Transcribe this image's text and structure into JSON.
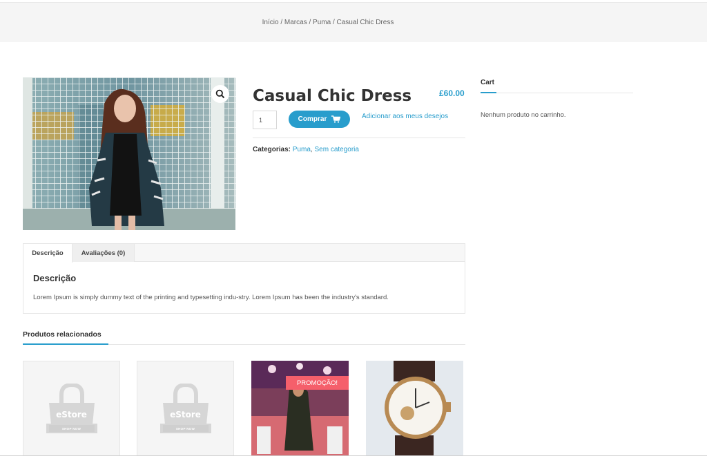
{
  "breadcrumb": {
    "items": [
      "Início",
      "Marcas",
      "Puma",
      "Casual Chic Dress"
    ],
    "separator": " / "
  },
  "product": {
    "title": "Casual Chic Dress",
    "price": "£60.00",
    "quantity": "1",
    "buy_label": "Comprar",
    "wishlist_label": "Adicionar aos meus desejos",
    "categories_label": "Categorias:",
    "categories": [
      "Puma",
      "Sem categoria"
    ],
    "image_icon": "zoom-icon"
  },
  "sidebar": {
    "cart_title": "Cart",
    "cart_empty": "Nenhum produto no carrinho."
  },
  "tabs": {
    "items": [
      {
        "label": "Descrição",
        "active": true
      },
      {
        "label": "Avaliações (0)",
        "active": false
      }
    ],
    "panel_title": "Descrição",
    "panel_text": "Lorem Ipsum is simply dummy text of the printing and typesetting indu-stry. Lorem Ipsum has been the industry's standard."
  },
  "related": {
    "title": "Produtos relacionados",
    "products": [
      {
        "type": "placeholder",
        "logo_text": "eStore",
        "logo_sub": "SHOP NOW"
      },
      {
        "type": "placeholder",
        "logo_text": "eStore",
        "logo_sub": "SHOP NOW"
      },
      {
        "type": "photo",
        "badge": "PROMOÇÃO!"
      },
      {
        "type": "photo"
      }
    ]
  },
  "colors": {
    "accent": "#289dcc",
    "sale": "#f55f6b"
  }
}
